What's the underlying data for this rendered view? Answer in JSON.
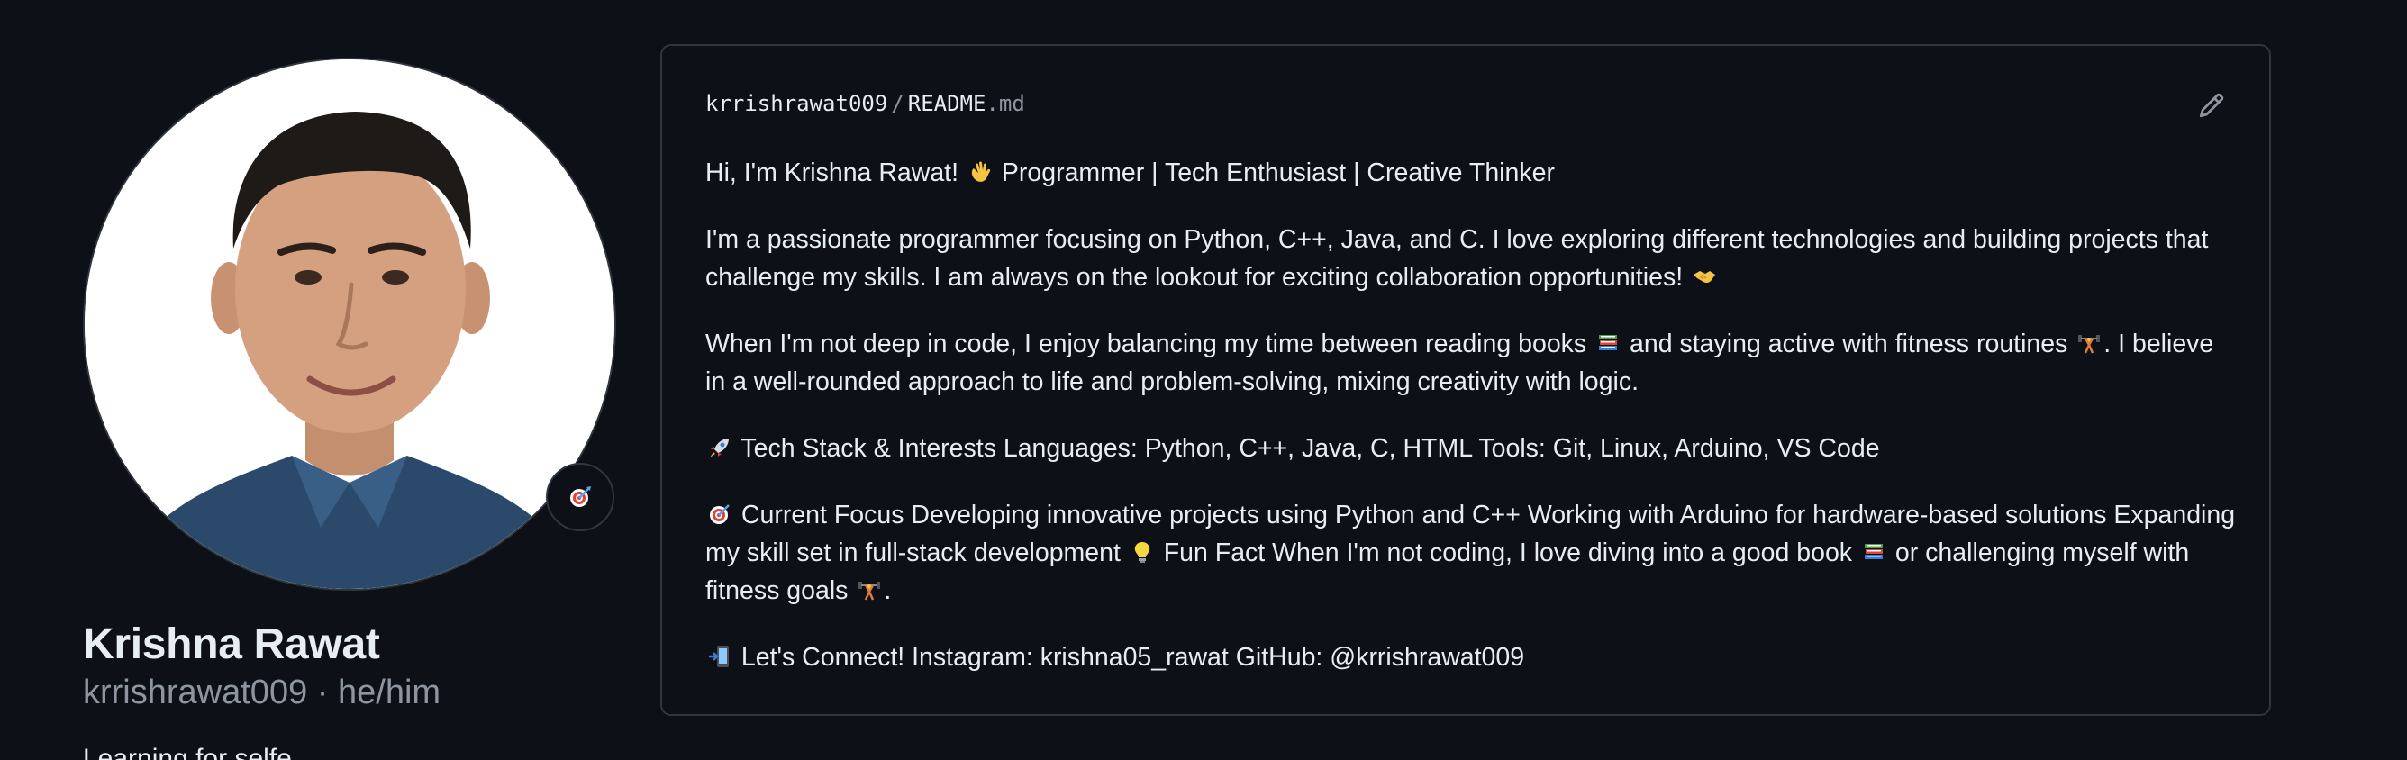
{
  "profile": {
    "name": "Krishna Rawat",
    "username": "krrishrawat009",
    "separator": " · ",
    "pronouns": "he/him",
    "bio": "Learning for selfe",
    "status_icon": "dart-icon"
  },
  "readme": {
    "owner": "krrishrawat009",
    "path_separator": "/",
    "file_name": "README",
    "file_ext": ".md",
    "edit_icon": "pencil-icon",
    "intro": {
      "before": "Hi, I'm Krishna Rawat! ",
      "after": " Programmer | Tech Enthusiast | Creative Thinker",
      "emoji": "waving-hand-icon"
    },
    "about": {
      "text": "I'm a passionate programmer focusing on Python, C++, Java, and C. I love exploring different technologies and building projects that challenge my skills. I am always on the lookout for exciting collaboration opportunities! ",
      "emoji": "handshake-icon"
    },
    "hobbies": {
      "part1": "When I'm not deep in code, I enjoy balancing my time between reading books ",
      "part2": " and staying active with fitness routines ",
      "part3": ". I believe in a well-rounded approach to life and problem-solving, mixing creativity with logic."
    },
    "tech_stack": {
      "text": " Tech Stack & Interests Languages: Python, C++, Java, C, HTML Tools: Git, Linux, Arduino, VS Code",
      "emoji": "rocket-icon"
    },
    "focus": {
      "part1": " Current Focus Developing innovative projects using Python and C++ Working with Arduino for hardware-based solutions Expanding my skill set in full-stack development ",
      "part2": " Fun Fact When I'm not coding, I love diving into a good book ",
      "part3": " or challenging myself with fitness goals ",
      "part4": "."
    },
    "connect": {
      "text": " Let's Connect! Instagram: krishna05_rawat GitHub: @krrishrawat009",
      "emoji": "mobile-arrow-icon"
    }
  },
  "colors": {
    "background": "#0d1117",
    "border": "#30363d",
    "text": "#e6edf3",
    "muted": "#8d96a0"
  }
}
